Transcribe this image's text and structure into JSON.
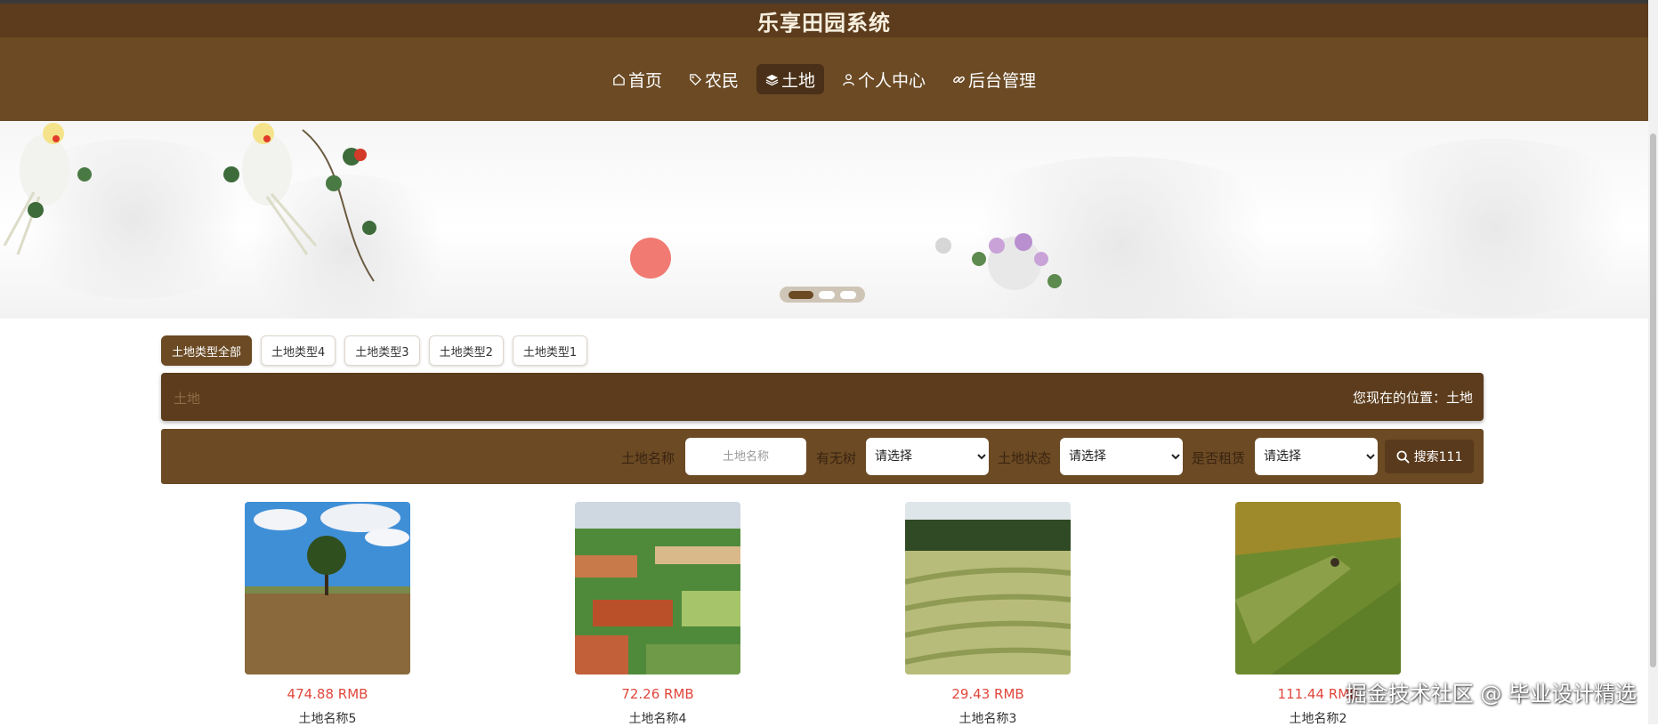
{
  "header": {
    "title": "乐享田园系统"
  },
  "nav": {
    "items": [
      {
        "label": "首页",
        "icon": "home-icon"
      },
      {
        "label": "农民",
        "icon": "tag-icon"
      },
      {
        "label": "土地",
        "icon": "stack-icon",
        "active": true
      },
      {
        "label": "个人中心",
        "icon": "user-icon"
      },
      {
        "label": "后台管理",
        "icon": "link-icon"
      }
    ]
  },
  "banner": {
    "active_slide": 1,
    "slide_count": 3
  },
  "tabs": [
    "土地类型全部",
    "土地类型4",
    "土地类型3",
    "土地类型2",
    "土地类型1"
  ],
  "breadcrumb": {
    "left": "土地",
    "right": "您现在的位置：土地"
  },
  "search": {
    "name_label": "土地名称",
    "name_placeholder": "土地名称",
    "trees_label": "有无树",
    "status_label": "土地状态",
    "rented_label": "是否租赁",
    "select_value": "请选择",
    "button_label": "搜索111"
  },
  "cards": [
    {
      "price": "474.88 RMB",
      "name": "土地名称5"
    },
    {
      "price": "72.26 RMB",
      "name": "土地名称4"
    },
    {
      "price": "29.43 RMB",
      "name": "土地名称3"
    },
    {
      "price": "111.44 RMB",
      "name": "土地名称2"
    }
  ],
  "watermark": "掘金技术社区 @ 毕业设计精选",
  "colors": {
    "brand": "#6b4a24",
    "brand_dark": "#5c3c1c",
    "price": "#e0473c"
  }
}
